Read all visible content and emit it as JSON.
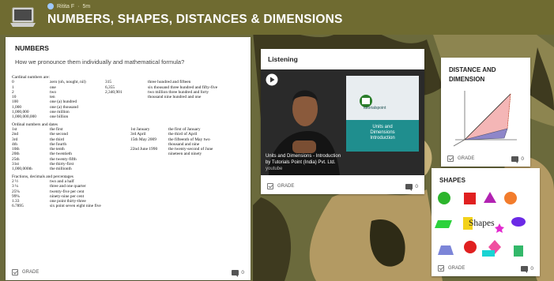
{
  "header": {
    "title": "NUMBERS, SHAPES, DISTANCES & DIMENSIONS",
    "author": "Ritita F",
    "time": "5m",
    "color": "#6f6b31"
  },
  "cards": {
    "numbers": {
      "title": "NUMBERS",
      "subtitle": "How we pronounce them individually and mathematical formula?",
      "cardinal_heading": "Cardinal numbers are:",
      "cardinal_rows": [
        [
          "0",
          "zero (oh, nought, nil)",
          "315",
          "three hundred and fifteen"
        ],
        [
          "1",
          "one",
          "6,355",
          "six thousand three hundred and fifty-five"
        ],
        [
          "2",
          "two",
          "2,340,901",
          "two million three hundred and forty"
        ],
        [
          "10",
          "ten",
          "",
          "thousand nine hundred and one"
        ],
        [
          "100",
          "one (a) hundred",
          "",
          ""
        ],
        [
          "1,000",
          "one (a) thousand",
          "",
          ""
        ],
        [
          "1,000,000",
          "one million",
          "",
          ""
        ],
        [
          "1,000,000,000",
          "one billion",
          "",
          ""
        ]
      ],
      "ordinal_heading": "Ordinal numbers and dates",
      "ordinal_rows": [
        [
          "1st",
          "the first",
          "1st January",
          "the first of January"
        ],
        [
          "2nd",
          "the second",
          "3rd April",
          "the third of April"
        ],
        [
          "3rd",
          "the third",
          "15th May 2009",
          "the fifteenth of May two"
        ],
        [
          "4th",
          "the fourth",
          "",
          "thousand and nine"
        ],
        [
          "10th",
          "the tenth",
          "22nd June 1990",
          "the twenty-second of June"
        ],
        [
          "20th",
          "the twentieth",
          "",
          "nineteen and ninety"
        ],
        [
          "25th",
          "the twenty-fifth",
          "",
          ""
        ],
        [
          "31st",
          "the thirty-first",
          "",
          ""
        ],
        [
          "1,000,000th",
          "the millionth",
          "",
          ""
        ]
      ],
      "fractions_heading": "Fractions, decimals and percentages",
      "fraction_rows": [
        [
          "2 ½",
          "two and a half"
        ],
        [
          "3 ¼",
          "three and one quarter"
        ],
        [
          "25%",
          "twenty-five per cent"
        ],
        [
          "99%",
          "ninety-nine per cent"
        ],
        [
          "1.33",
          "one point thirty-three"
        ],
        [
          "6.7895",
          "six point seven eight nine five"
        ]
      ],
      "grade_label": "GRADE",
      "comment_count": "0"
    },
    "listening": {
      "title": "Listening",
      "video_title": "Units and Dimensions - Introduction",
      "video_channel": "by Tutorials Point (India) Pvt. Ltd.",
      "video_source": "youtube",
      "slide_brand": "tutorialspoint",
      "slide_text_1": "Units and",
      "slide_text_2": "Dimensions",
      "slide_text_3": "Introduction",
      "grade_label": "GRADE",
      "comment_count": "0"
    },
    "distance": {
      "title_line1": "DISTANCE AND",
      "title_line2": "DIMENSION",
      "grade_label": "GRADE",
      "comment_count": "0"
    },
    "shapes": {
      "title": "SHAPES",
      "image_word": "Shapes",
      "grade_label": "GRADE",
      "comment_count": "0"
    }
  },
  "colors": {
    "camo_dark": "#3e3a1f",
    "camo_olive": "#6b6a3c",
    "camo_tan": "#b39a63"
  },
  "icons": [
    "laptop-icon",
    "play-icon",
    "checkmark-icon",
    "comment-icon"
  ]
}
